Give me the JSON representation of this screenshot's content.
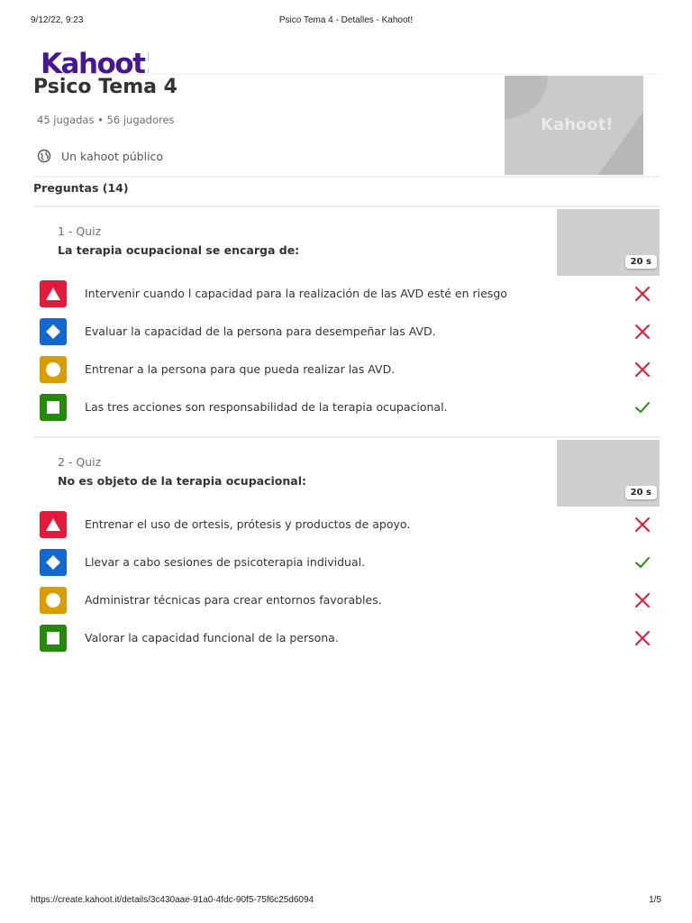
{
  "print_header": {
    "datetime": "9/12/22, 9:23",
    "page_title": "Psico Tema 4 - Detalles - Kahoot!"
  },
  "logo": {
    "text": "Kahoot!"
  },
  "kahoot": {
    "title": "Psico Tema 4",
    "stats": "45 jugadas • 56 jugadores",
    "visibility": "Un kahoot público",
    "cover_logo_text": "Kahoot!"
  },
  "questions_header": "Preguntas (14)",
  "questions": [
    {
      "type_label": "1 - Quiz",
      "title": "La terapia ocupacional se encarga de:",
      "time": "20 s",
      "answers": [
        {
          "shape": "triangle-icon",
          "color": "#e21b3c",
          "text": "Intervenir cuando l capacidad para la realización de las AVD esté en riesgo",
          "correct": false
        },
        {
          "shape": "diamond-icon",
          "color": "#1368ce",
          "text": "Evaluar la capacidad de la persona para desempeñar las AVD.",
          "correct": false
        },
        {
          "shape": "circle-icon",
          "color": "#d89e00",
          "text": "Entrenar a la persona para que pueda realizar las AVD.",
          "correct": false
        },
        {
          "shape": "square-icon",
          "color": "#26890c",
          "text": "Las tres acciones son responsabilidad de la terapia ocupacional.",
          "correct": true
        }
      ]
    },
    {
      "type_label": "2 - Quiz",
      "title": "No es objeto de la terapia ocupacional:",
      "time": "20 s",
      "answers": [
        {
          "shape": "triangle-icon",
          "color": "#e21b3c",
          "text": "Entrenar el uso de ortesis, prótesis y productos de apoyo.",
          "correct": false
        },
        {
          "shape": "diamond-icon",
          "color": "#1368ce",
          "text": "Llevar a cabo sesiones de psicoterapia individual.",
          "correct": true
        },
        {
          "shape": "circle-icon",
          "color": "#d89e00",
          "text": "Administrar técnicas para crear entornos favorables.",
          "correct": false
        },
        {
          "shape": "square-icon",
          "color": "#26890c",
          "text": "Valorar la capacidad funcional de la persona.",
          "correct": false
        }
      ]
    }
  ],
  "print_footer": {
    "url": "https://create.kahoot.it/details/3c430aae-91a0-4fdc-90f5-75f6c25d6094",
    "page": "1/5"
  },
  "colors": {
    "brand_purple": "#46178f",
    "correct_green": "#26890c",
    "wrong_red": "#e21b3c"
  }
}
